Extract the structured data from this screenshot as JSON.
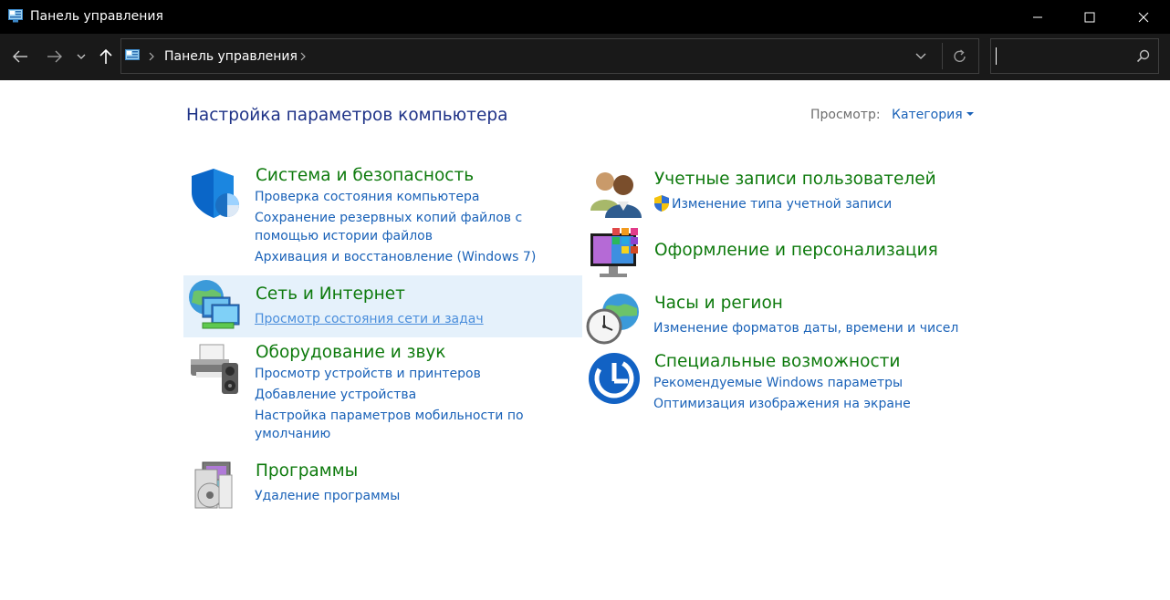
{
  "window": {
    "title": "Панель управления"
  },
  "toolbar": {
    "breadcrumb": "Панель управления",
    "search_placeholder": ""
  },
  "header": {
    "page_title": "Настройка параметров компьютера",
    "view_label": "Просмотр:",
    "view_value": "Категория"
  },
  "categories": {
    "system": {
      "title": "Система и безопасность",
      "links": [
        "Проверка состояния компьютера",
        "Сохранение резервных копий файлов с",
        "помощью истории файлов",
        "Архивация и восстановление (Windows 7)"
      ]
    },
    "network": {
      "title": "Сеть и Интернет",
      "links": [
        "Просмотр состояния сети и задач"
      ]
    },
    "hardware": {
      "title": "Оборудование и звук",
      "links": [
        "Просмотр устройств и принтеров",
        "Добавление устройства",
        "Настройка параметров мобильности по",
        "умолчанию"
      ]
    },
    "programs": {
      "title": "Программы",
      "links": [
        "Удаление программы"
      ]
    },
    "accounts": {
      "title": "Учетные записи пользователей",
      "links": [
        "Изменение типа учетной записи"
      ]
    },
    "appearance": {
      "title": "Оформление и персонализация",
      "links": []
    },
    "clock": {
      "title": "Часы и регион",
      "links": [
        "Изменение форматов даты, времени и чисел"
      ]
    },
    "ease": {
      "title": "Специальные возможности",
      "links": [
        "Рекомендуемые Windows параметры",
        "Оптимизация изображения на экране"
      ]
    }
  },
  "colors": {
    "category_title": "#0e7a0d",
    "link": "#1a62b8",
    "page_title": "#1e3287",
    "hover": "#e5f1fb"
  }
}
